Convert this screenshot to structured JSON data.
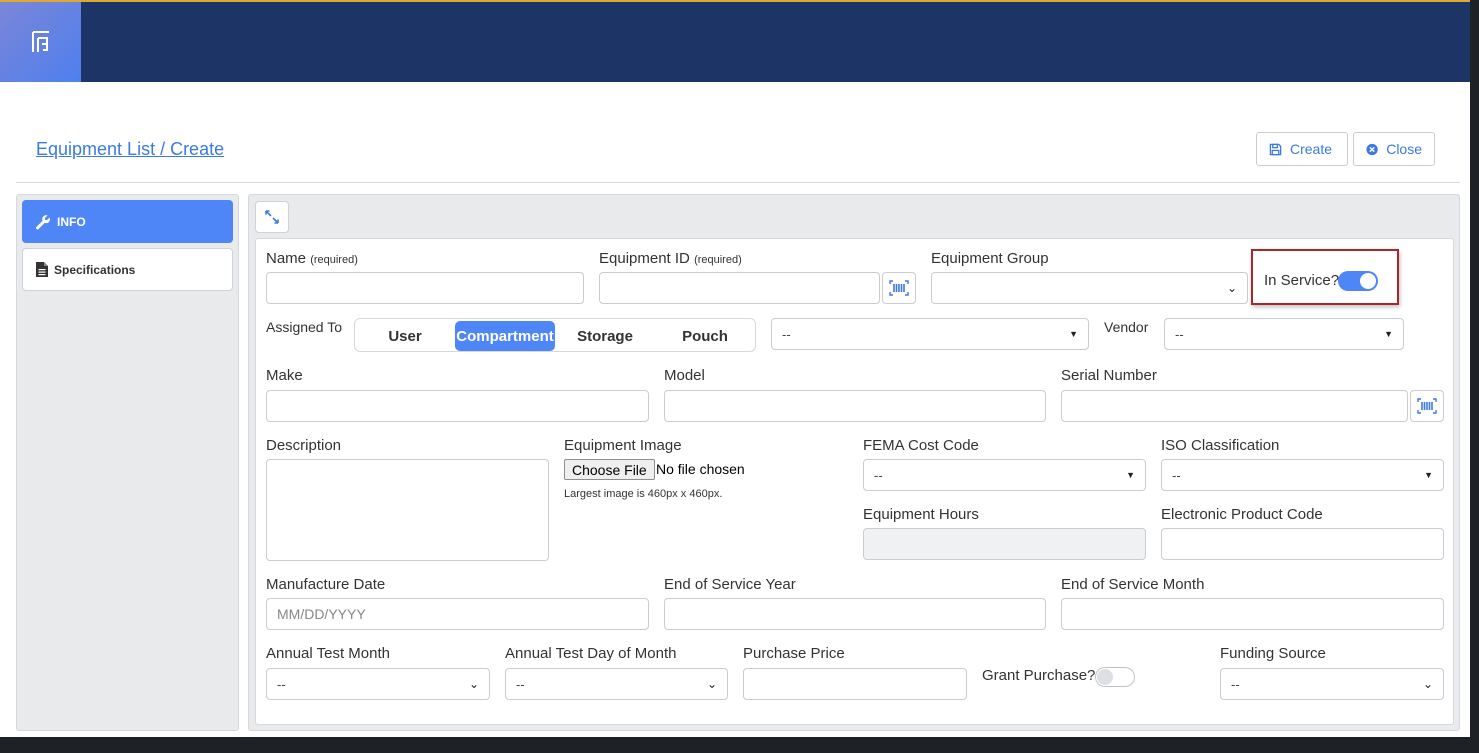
{
  "header": {
    "logo_icon": "app-logo-icon",
    "breadcrumb": "Equipment List / Create",
    "create_label": "Create",
    "close_label": "Close"
  },
  "sidebar": {
    "tabs": [
      {
        "label": "INFO",
        "icon": "wrench-icon",
        "active": true
      },
      {
        "label": "Specifications",
        "icon": "document-icon",
        "active": false
      }
    ]
  },
  "form": {
    "name": {
      "label": "Name",
      "note": "(required)",
      "value": ""
    },
    "equipment_id": {
      "label": "Equipment ID",
      "note": "(required)",
      "value": ""
    },
    "equipment_group": {
      "label": "Equipment Group",
      "value": ""
    },
    "in_service": {
      "label": "In Service?",
      "on": true
    },
    "assigned_to": {
      "label": "Assigned To",
      "options": [
        "User",
        "Compartment",
        "Storage",
        "Pouch"
      ],
      "selected": "Compartment",
      "target_value": "--"
    },
    "vendor": {
      "label": "Vendor",
      "value": "--"
    },
    "make": {
      "label": "Make",
      "value": ""
    },
    "model": {
      "label": "Model",
      "value": ""
    },
    "serial_number": {
      "label": "Serial Number",
      "value": ""
    },
    "description": {
      "label": "Description",
      "value": ""
    },
    "equipment_image": {
      "label": "Equipment Image",
      "button": "Choose File",
      "status": "No file chosen",
      "hint": "Largest image is 460px x 460px."
    },
    "fema_cost_code": {
      "label": "FEMA Cost Code",
      "value": "--"
    },
    "iso_classification": {
      "label": "ISO Classification",
      "value": "--"
    },
    "equipment_hours": {
      "label": "Equipment Hours",
      "value": ""
    },
    "electronic_product_code": {
      "label": "Electronic Product Code",
      "value": ""
    },
    "manufacture_date": {
      "label": "Manufacture Date",
      "placeholder": "MM/DD/YYYY"
    },
    "end_of_service_year": {
      "label": "End of Service Year",
      "value": ""
    },
    "end_of_service_month": {
      "label": "End of Service Month",
      "value": ""
    },
    "annual_test_month": {
      "label": "Annual Test Month",
      "value": "--"
    },
    "annual_test_day": {
      "label": "Annual Test Day of Month",
      "value": "--"
    },
    "purchase_price": {
      "label": "Purchase Price",
      "value": ""
    },
    "grant_purchase": {
      "label": "Grant Purchase?",
      "on": false
    },
    "funding_source": {
      "label": "Funding Source",
      "value": "--"
    }
  },
  "colors": {
    "topbar": "#1c3566",
    "accent": "#4f86f7",
    "link": "#3c7ae0",
    "highlight_border": "#a4282c"
  }
}
